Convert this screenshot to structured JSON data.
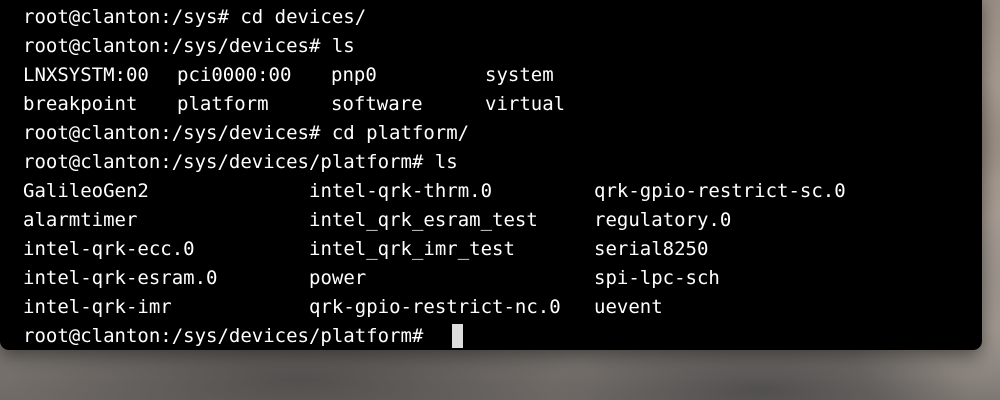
{
  "terminal": {
    "lines": [
      {
        "text": "root@clanton:/sys# cd devices/"
      },
      {
        "text": "root@clanton:/sys/devices# ls"
      },
      {
        "cols": [
          "LNXSYSTM:00",
          "pci0000:00",
          "pnp0",
          "system"
        ]
      },
      {
        "cols": [
          "breakpoint",
          "platform",
          "software",
          "virtual"
        ]
      },
      {
        "text": "root@clanton:/sys/devices# cd platform/"
      },
      {
        "text": "root@clanton:/sys/devices/platform# ls"
      },
      {
        "cols": [
          "GalileoGen2",
          "intel-qrk-thrm.0",
          "qrk-gpio-restrict-sc.0"
        ]
      },
      {
        "cols": [
          "alarmtimer",
          "intel_qrk_esram_test",
          "regulatory.0"
        ]
      },
      {
        "cols": [
          "intel-qrk-ecc.0",
          "intel_qrk_imr_test",
          "serial8250"
        ]
      },
      {
        "cols": [
          "intel-qrk-esram.0",
          "power",
          "spi-lpc-sch"
        ]
      },
      {
        "cols": [
          "intel-qrk-imr",
          "qrk-gpio-restrict-nc.0",
          "uevent"
        ]
      },
      {
        "text": "root@clanton:/sys/devices/platform# "
      }
    ],
    "cursor_visible": true,
    "colors": {
      "background": "#000000",
      "foreground": "#ffffff",
      "cursor": "#dcdcdc"
    }
  }
}
